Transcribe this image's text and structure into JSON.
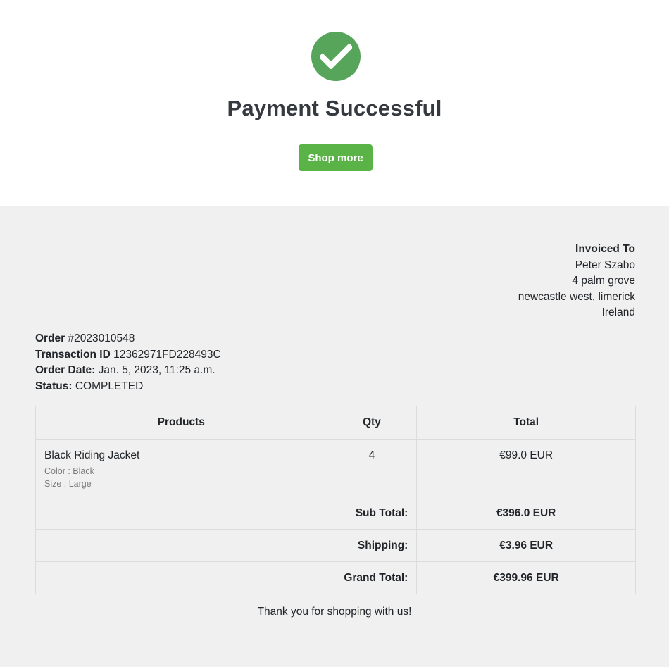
{
  "hero": {
    "icon": "check-circle-icon",
    "icon_color": "#57a55a",
    "title": "Payment Successful",
    "shop_more_label": "Shop more",
    "button_color": "#5ab347"
  },
  "invoiced_to": {
    "heading": "Invoiced To",
    "name": "Peter Szabo",
    "address_line1": "4 palm grove",
    "address_line2": "newcastle west, limerick",
    "country": "Ireland"
  },
  "order": {
    "order_label": "Order",
    "order_number": "#2023010548",
    "transaction_label": "Transaction ID",
    "transaction_id": "12362971FD228493C",
    "date_label": "Order Date:",
    "date": "Jan. 5, 2023, 11:25 a.m.",
    "status_label": "Status:",
    "status": "COMPLETED"
  },
  "table": {
    "headers": {
      "products": "Products",
      "qty": "Qty",
      "total": "Total"
    },
    "items": [
      {
        "name": "Black Riding Jacket",
        "color": "Color : Black",
        "size": "Size : Large",
        "qty": "4",
        "total": "€99.0 EUR"
      }
    ],
    "sub_total_label": "Sub Total:",
    "sub_total": "€396.0 EUR",
    "shipping_label": "Shipping:",
    "shipping": "€3.96 EUR",
    "grand_total_label": "Grand Total:",
    "grand_total": "€399.96 EUR"
  },
  "footer": {
    "thanks": "Thank you for shopping with us!"
  }
}
